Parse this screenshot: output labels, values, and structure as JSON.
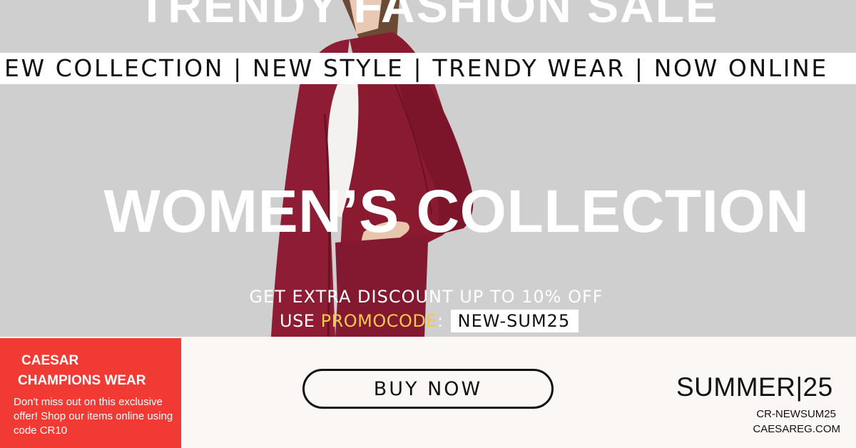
{
  "banner": {
    "top_title": "TRENDY FASHION SALE",
    "ticker": "EW COLLECTION | NEW STYLE | TRENDY WEAR | NOW ONLINE",
    "headline": "WOMEN’S COLLECTION",
    "discount": "GET EXTRA DISCOUNT UP TO 10% OFF",
    "promo_prefix": "USE ",
    "promo_word": "PROMOCODE",
    "promo_colon": ":",
    "promo_code": "NEW-SUM25"
  },
  "brand": {
    "name_line1": "CAESAR",
    "name_line2": "CHAMPIONS WEAR",
    "description": "Don't miss out on this exclusive offer! Shop our items online using code CR10"
  },
  "cta": {
    "label": "BUY NOW"
  },
  "footer": {
    "season": "SUMMER|25",
    "code": "CR-NEWSUM25",
    "website": "CAESAREG.COM"
  },
  "colors": {
    "background": "#cfcfcf",
    "accent_red": "#f23a35",
    "promo_yellow": "#f5c84b",
    "garment": "#8e1c34"
  },
  "icons": {
    "model": "model-photo"
  }
}
